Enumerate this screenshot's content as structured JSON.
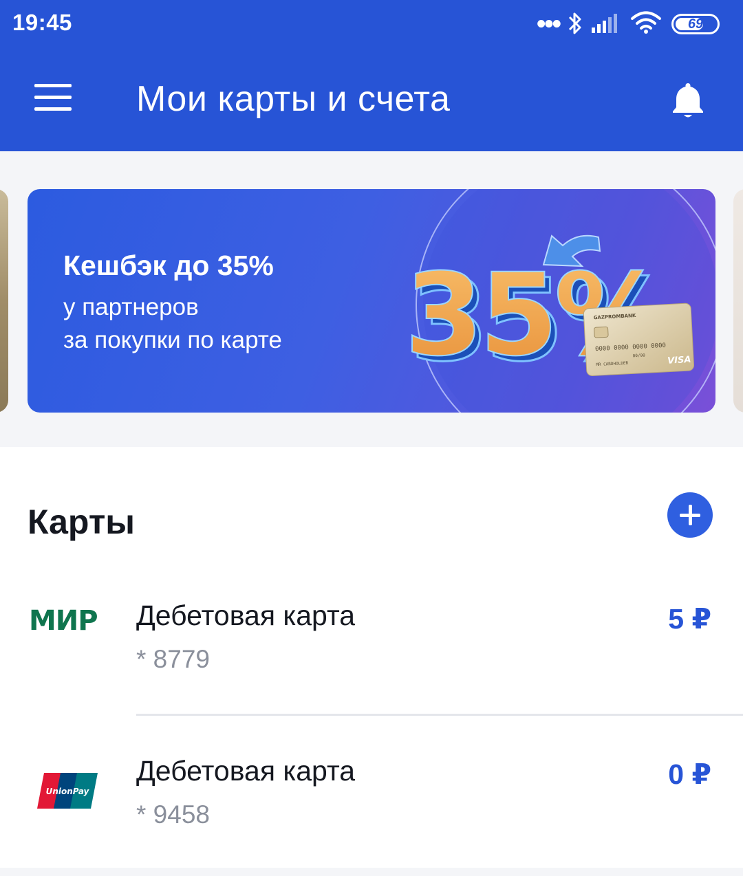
{
  "status_bar": {
    "time": "19:45",
    "battery": "69",
    "icons": [
      "more-dots-icon",
      "bluetooth-icon",
      "signal-icon",
      "wifi-icon",
      "battery-icon"
    ]
  },
  "header": {
    "title": "Мои карты и счета",
    "icons": [
      "menu-icon",
      "bell-icon"
    ]
  },
  "banner": {
    "title": "Кешбэк до 35%",
    "subtitle_line1": "у партнеров",
    "subtitle_line2": "за покупки по карте",
    "art_text": "35%",
    "card_bank": "GAZPROMBANK",
    "card_number": "0000 0000 0000 0000",
    "card_valid": "00/00",
    "card_holder": "MR CARDHOLDER",
    "card_brand": "VISA"
  },
  "cards": {
    "section_title": "Карты",
    "add_icon": "plus-icon",
    "items": [
      {
        "logo": "МИР",
        "logo_icon": "mir-logo-icon",
        "name": "Дебетовая карта",
        "number": "* 8779",
        "amount": "5 ₽"
      },
      {
        "logo": "UnionPay",
        "logo_icon": "unionpay-logo-icon",
        "name": "Дебетовая карта",
        "number": "* 9458",
        "amount": "0 ₽"
      }
    ]
  },
  "colors": {
    "primary": "#2754d6",
    "accent_button": "#2f5fe0",
    "text_dark": "#151820",
    "text_muted": "#8a8f9b",
    "mir_green": "#0f754e",
    "banner_orange": "#f3a64a"
  }
}
